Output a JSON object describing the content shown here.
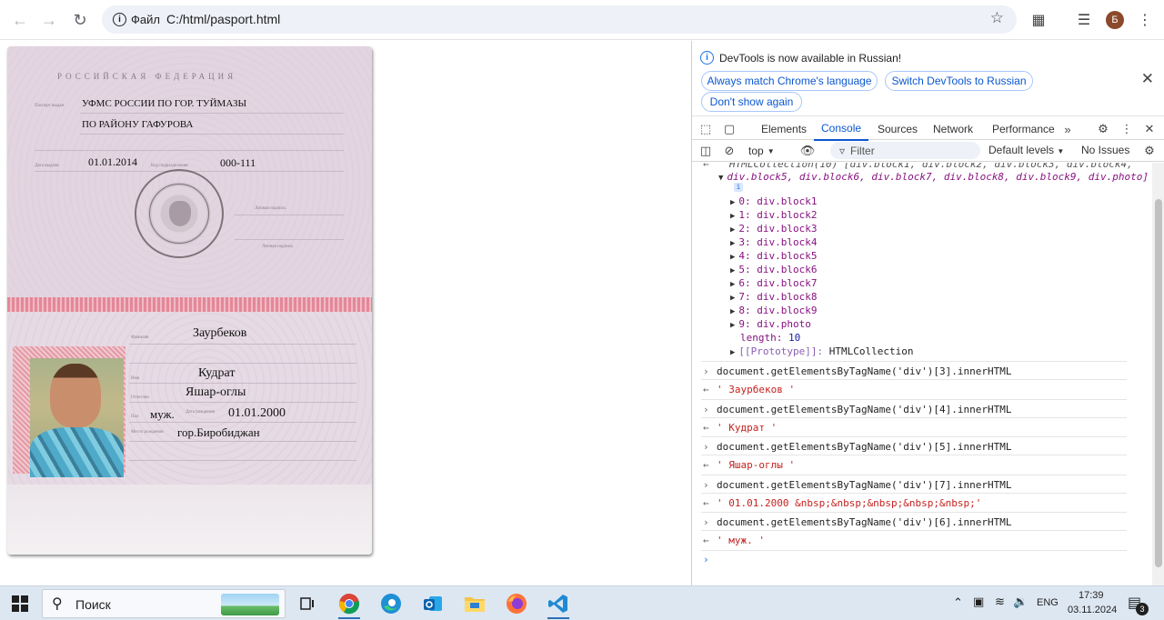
{
  "browser": {
    "site_chip_label": "Файл",
    "url": "C:/html/pasport.html",
    "profile_initial": "Б"
  },
  "passport": {
    "header": "РОССИЙСКАЯ ФЕДЕРАЦИЯ",
    "issued_by_line1": "УФМС РОССИИ ПО ГОР. ТУЙМАЗЫ",
    "issued_by_line2": "ПО РАЙОНУ ГАФУРОВА",
    "issue_date": "01.01.2014",
    "division_code": "000-111",
    "surname": "Заурбеков",
    "name": "Кудрат",
    "patronymic": "Яшар-оглы",
    "sex": "муж.",
    "birth_date": "01.01.2000",
    "birth_place": "гор.Биробиджан",
    "small_labels": {
      "issued_by": "Паспорт выдан",
      "issue_date": "Дата выдачи",
      "division_code": "Код подразделения",
      "personal_sign": "Личная подпись",
      "signature": "Личная подпись",
      "surname": "Фамилия",
      "name": "Имя",
      "patronymic": "Отчество",
      "sex": "Пол",
      "birth_date": "Дата рождения",
      "birth_place": "Место рождения"
    }
  },
  "devtools": {
    "info_message": "DevTools is now available in Russian!",
    "btn_match_language": "Always match Chrome's language",
    "btn_switch_russian": "Switch DevTools to Russian",
    "btn_dont_show": "Don't show again",
    "tabs": [
      "Elements",
      "Console",
      "Sources",
      "Network",
      "Performance"
    ],
    "active_tab": "Console",
    "context": "top",
    "filter_placeholder": "Filter",
    "levels": "Default levels",
    "issues": "No Issues",
    "collection_header_1": "HTMLCollection(10) [div.block1, div.block2, div.block3, div.block4,",
    "collection_header_2": "div.block5, div.block6, div.block7, div.block8, div.block9, div.photo]",
    "collection_items": [
      {
        "index": "0:",
        "value": "div.block1"
      },
      {
        "index": "1:",
        "value": "div.block2"
      },
      {
        "index": "2:",
        "value": "div.block3"
      },
      {
        "index": "3:",
        "value": "div.block4"
      },
      {
        "index": "4:",
        "value": "div.block5"
      },
      {
        "index": "5:",
        "value": "div.block6"
      },
      {
        "index": "6:",
        "value": "div.block7"
      },
      {
        "index": "7:",
        "value": "div.block8"
      },
      {
        "index": "8:",
        "value": "div.block9"
      },
      {
        "index": "9:",
        "value": "div.photo"
      }
    ],
    "length_key": "length:",
    "length_value": "10",
    "prototype_key": "[[Prototype]]:",
    "prototype_value": "HTMLCollection",
    "entries": [
      {
        "input": "document.getElementsByTagName('div')[3].innerHTML",
        "output": "' Заурбеков '"
      },
      {
        "input": "document.getElementsByTagName('div')[4].innerHTML",
        "output": "' Кудрат '"
      },
      {
        "input": "document.getElementsByTagName('div')[5].innerHTML",
        "output": "' Яшар-оглы '"
      },
      {
        "input": "document.getElementsByTagName('div')[7].innerHTML",
        "output": "' 01.01.2000 &nbsp;&nbsp;&nbsp;&nbsp;&nbsp;'"
      },
      {
        "input": "document.getElementsByTagName('div')[6].innerHTML",
        "output": "' муж. '"
      }
    ]
  },
  "taskbar": {
    "search_label": "Поиск",
    "language": "ENG",
    "time": "17:39",
    "date": "03.11.2024",
    "notification_count": "3"
  }
}
